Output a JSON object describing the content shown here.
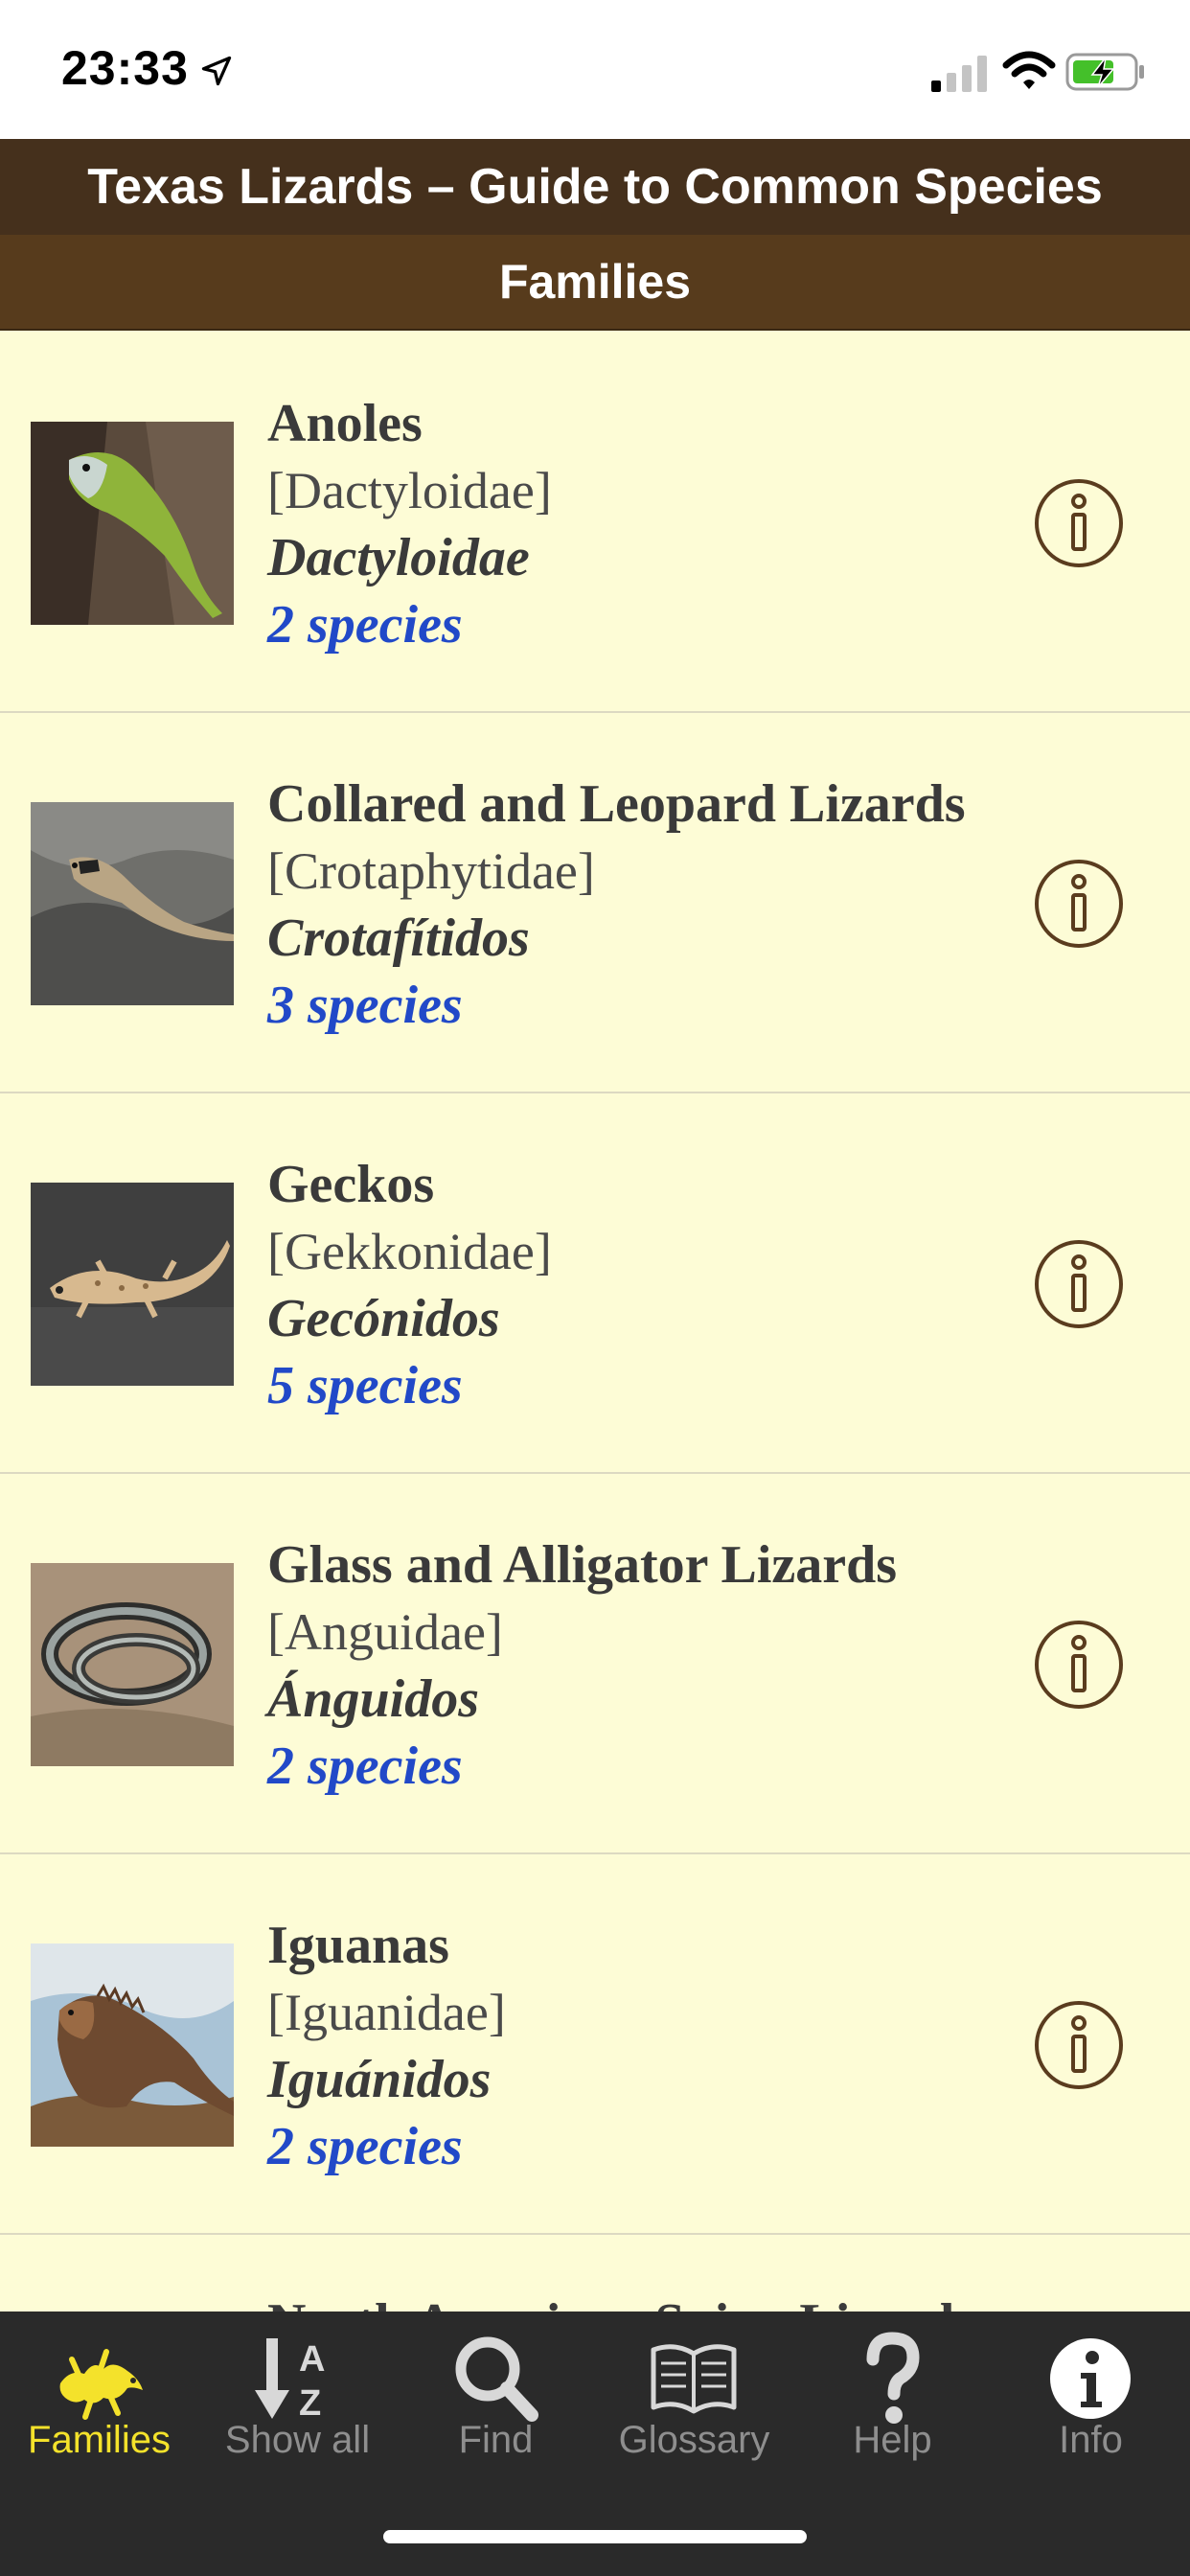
{
  "status_bar": {
    "time": "23:33",
    "icons": [
      "location-arrow-icon",
      "cellular-signal-icon",
      "wifi-icon",
      "battery-charging-icon"
    ]
  },
  "header": {
    "title": "Texas Lizards – Guide to Common Species",
    "section": "Families"
  },
  "families": [
    {
      "common": "Anoles",
      "scientific": "[Dactyloidae]",
      "spanish": "Dactyloidae",
      "count": "2 species"
    },
    {
      "common": "Collared and Leopard Lizards",
      "scientific": "[Crotaphytidae]",
      "spanish": "Crotafítidos",
      "count": "3 species"
    },
    {
      "common": "Geckos",
      "scientific": "[Gekkonidae]",
      "spanish": "Gecónidos",
      "count": "5 species"
    },
    {
      "common": "Glass and Alligator Lizards",
      "scientific": "[Anguidae]",
      "spanish": "Ánguidos",
      "count": "2 species"
    },
    {
      "common": "Iguanas",
      "scientific": "[Iguanidae]",
      "spanish": "Iguánidos",
      "count": "2 species"
    }
  ],
  "partial_row": {
    "common": "North American Spiny Lizards"
  },
  "tabs": [
    {
      "label": "Families",
      "icon": "lizard-icon",
      "active": true
    },
    {
      "label": "Show all",
      "icon": "sort-az-icon",
      "active": false
    },
    {
      "label": "Find",
      "icon": "search-icon",
      "active": false
    },
    {
      "label": "Glossary",
      "icon": "book-icon",
      "active": false
    },
    {
      "label": "Help",
      "icon": "question-icon",
      "active": false
    },
    {
      "label": "Info",
      "icon": "info-icon",
      "active": false
    }
  ],
  "colors": {
    "header_bg": "#45301c",
    "section_bg": "#573b1c",
    "list_bg": "#fdfcd6",
    "species_link": "#2149c8",
    "active_tab": "#f4e22b",
    "tab_bar_bg": "#2a2a2a"
  }
}
